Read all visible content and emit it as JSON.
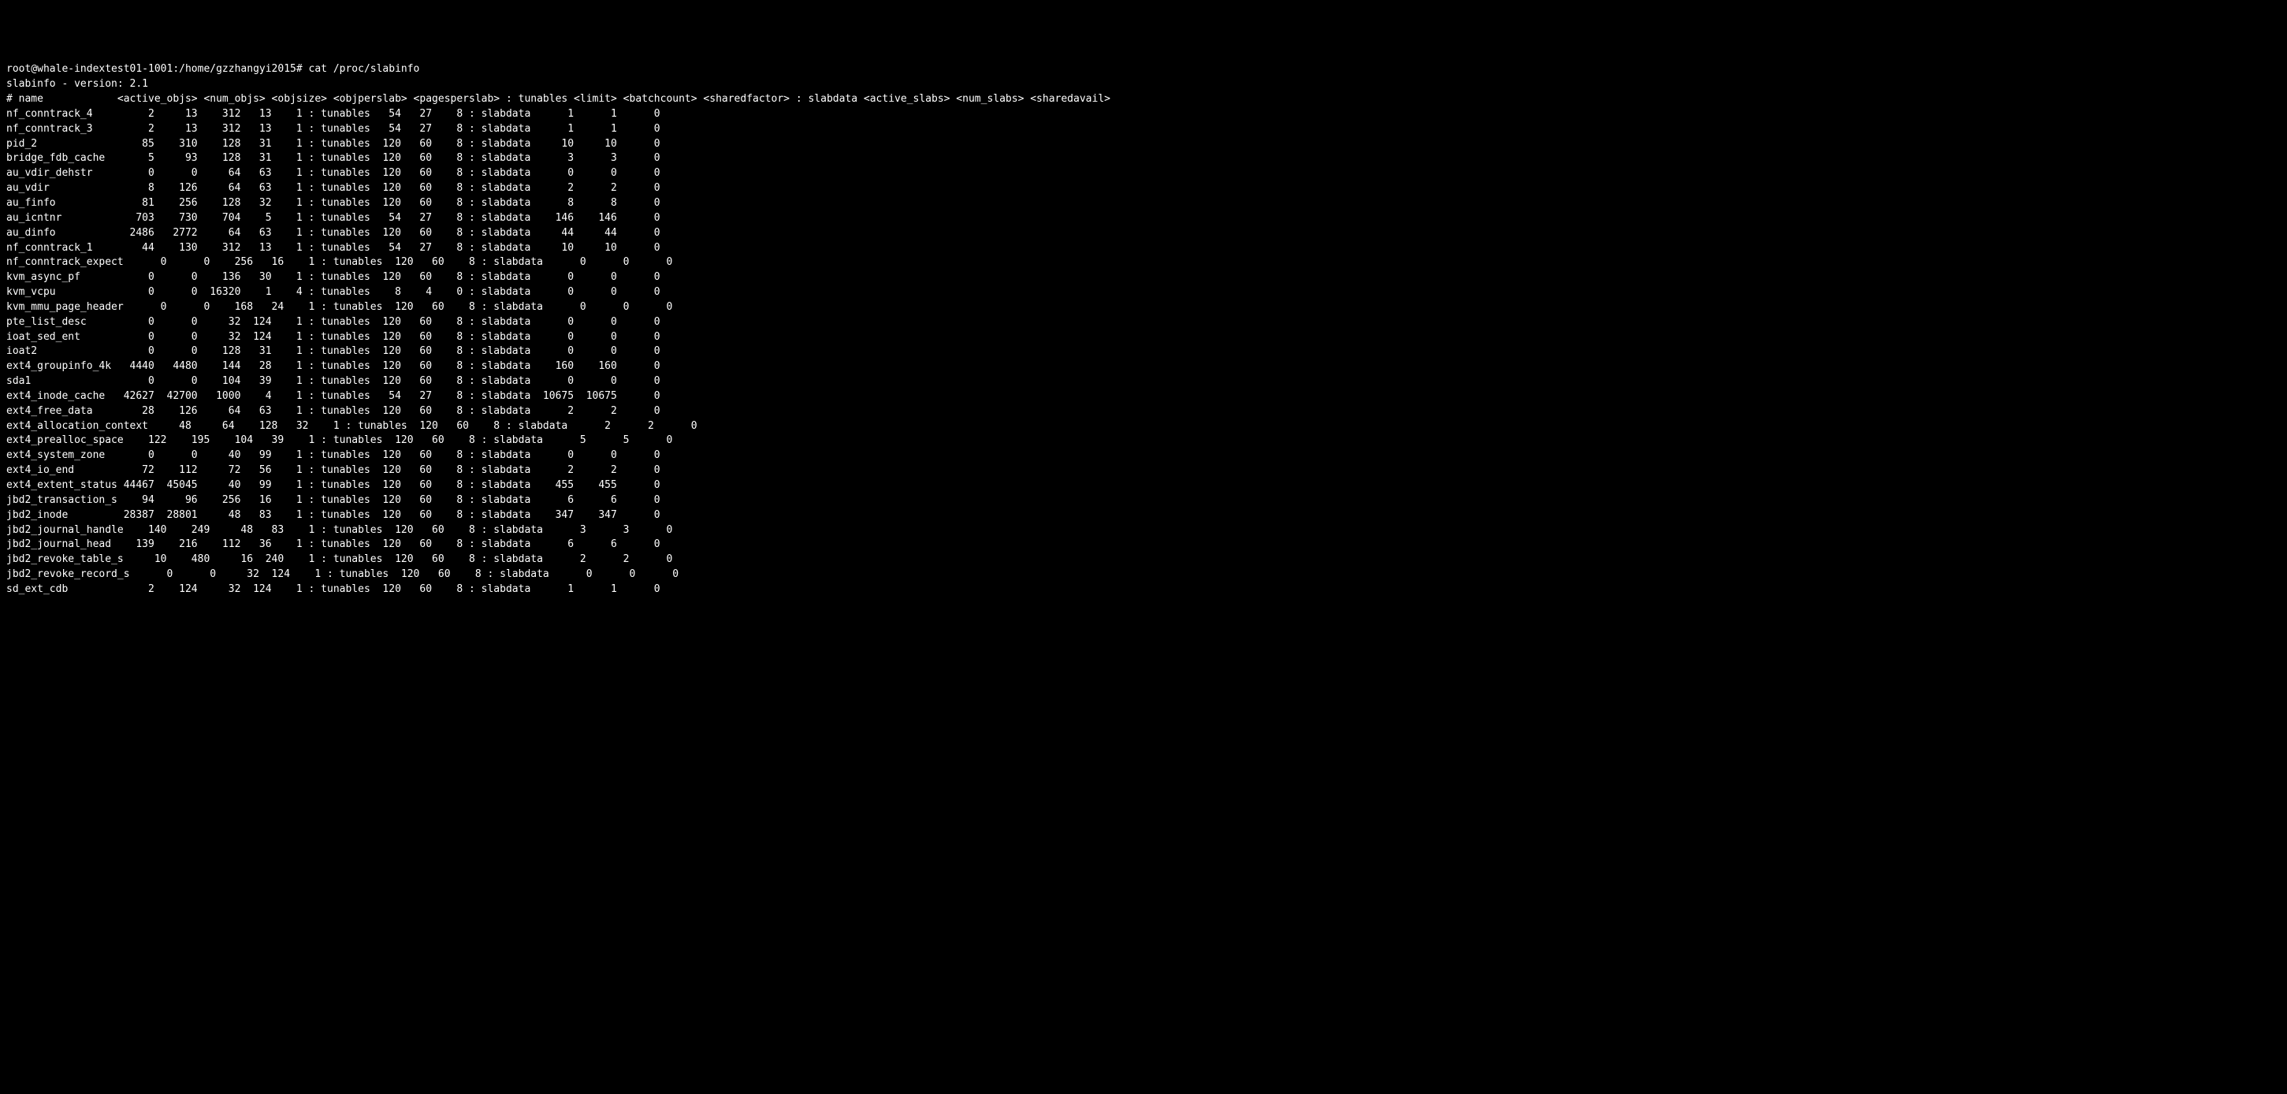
{
  "prompt": "root@whale-indextest01-1001:/home/gzzhangyi2015# ",
  "command": "cat /proc/slabinfo",
  "version_line": "slabinfo - version: 2.1",
  "header_line": "# name            <active_objs> <num_objs> <objsize> <objperslab> <pagesperslab> : tunables <limit> <batchcount> <sharedfactor> : slabdata <active_slabs> <num_slabs> <sharedavail>",
  "rows": [
    {
      "name": "nf_conntrack_4",
      "active_objs": 2,
      "num_objs": 13,
      "objsize": 312,
      "objperslab": 13,
      "pagesperslab": 1,
      "limit": 54,
      "batchcount": 27,
      "sharedfactor": 8,
      "active_slabs": 1,
      "num_slabs": 1,
      "sharedavail": 0
    },
    {
      "name": "nf_conntrack_3",
      "active_objs": 2,
      "num_objs": 13,
      "objsize": 312,
      "objperslab": 13,
      "pagesperslab": 1,
      "limit": 54,
      "batchcount": 27,
      "sharedfactor": 8,
      "active_slabs": 1,
      "num_slabs": 1,
      "sharedavail": 0
    },
    {
      "name": "pid_2",
      "active_objs": 85,
      "num_objs": 310,
      "objsize": 128,
      "objperslab": 31,
      "pagesperslab": 1,
      "limit": 120,
      "batchcount": 60,
      "sharedfactor": 8,
      "active_slabs": 10,
      "num_slabs": 10,
      "sharedavail": 0
    },
    {
      "name": "bridge_fdb_cache",
      "active_objs": 5,
      "num_objs": 93,
      "objsize": 128,
      "objperslab": 31,
      "pagesperslab": 1,
      "limit": 120,
      "batchcount": 60,
      "sharedfactor": 8,
      "active_slabs": 3,
      "num_slabs": 3,
      "sharedavail": 0
    },
    {
      "name": "au_vdir_dehstr",
      "active_objs": 0,
      "num_objs": 0,
      "objsize": 64,
      "objperslab": 63,
      "pagesperslab": 1,
      "limit": 120,
      "batchcount": 60,
      "sharedfactor": 8,
      "active_slabs": 0,
      "num_slabs": 0,
      "sharedavail": 0
    },
    {
      "name": "au_vdir",
      "active_objs": 8,
      "num_objs": 126,
      "objsize": 64,
      "objperslab": 63,
      "pagesperslab": 1,
      "limit": 120,
      "batchcount": 60,
      "sharedfactor": 8,
      "active_slabs": 2,
      "num_slabs": 2,
      "sharedavail": 0
    },
    {
      "name": "au_finfo",
      "active_objs": 81,
      "num_objs": 256,
      "objsize": 128,
      "objperslab": 32,
      "pagesperslab": 1,
      "limit": 120,
      "batchcount": 60,
      "sharedfactor": 8,
      "active_slabs": 8,
      "num_slabs": 8,
      "sharedavail": 0
    },
    {
      "name": "au_icntnr",
      "active_objs": 703,
      "num_objs": 730,
      "objsize": 704,
      "objperslab": 5,
      "pagesperslab": 1,
      "limit": 54,
      "batchcount": 27,
      "sharedfactor": 8,
      "active_slabs": 146,
      "num_slabs": 146,
      "sharedavail": 0
    },
    {
      "name": "au_dinfo",
      "active_objs": 2486,
      "num_objs": 2772,
      "objsize": 64,
      "objperslab": 63,
      "pagesperslab": 1,
      "limit": 120,
      "batchcount": 60,
      "sharedfactor": 8,
      "active_slabs": 44,
      "num_slabs": 44,
      "sharedavail": 0
    },
    {
      "name": "nf_conntrack_1",
      "active_objs": 44,
      "num_objs": 130,
      "objsize": 312,
      "objperslab": 13,
      "pagesperslab": 1,
      "limit": 54,
      "batchcount": 27,
      "sharedfactor": 8,
      "active_slabs": 10,
      "num_slabs": 10,
      "sharedavail": 0
    },
    {
      "name": "nf_conntrack_expect",
      "active_objs": 0,
      "num_objs": 0,
      "objsize": 256,
      "objperslab": 16,
      "pagesperslab": 1,
      "limit": 120,
      "batchcount": 60,
      "sharedfactor": 8,
      "active_slabs": 0,
      "num_slabs": 0,
      "sharedavail": 0
    },
    {
      "name": "kvm_async_pf",
      "active_objs": 0,
      "num_objs": 0,
      "objsize": 136,
      "objperslab": 30,
      "pagesperslab": 1,
      "limit": 120,
      "batchcount": 60,
      "sharedfactor": 8,
      "active_slabs": 0,
      "num_slabs": 0,
      "sharedavail": 0
    },
    {
      "name": "kvm_vcpu",
      "active_objs": 0,
      "num_objs": 0,
      "objsize": 16320,
      "objperslab": 1,
      "pagesperslab": 4,
      "limit": 8,
      "batchcount": 4,
      "sharedfactor": 0,
      "active_slabs": 0,
      "num_slabs": 0,
      "sharedavail": 0
    },
    {
      "name": "kvm_mmu_page_header",
      "active_objs": 0,
      "num_objs": 0,
      "objsize": 168,
      "objperslab": 24,
      "pagesperslab": 1,
      "limit": 120,
      "batchcount": 60,
      "sharedfactor": 8,
      "active_slabs": 0,
      "num_slabs": 0,
      "sharedavail": 0
    },
    {
      "name": "pte_list_desc",
      "active_objs": 0,
      "num_objs": 0,
      "objsize": 32,
      "objperslab": 124,
      "pagesperslab": 1,
      "limit": 120,
      "batchcount": 60,
      "sharedfactor": 8,
      "active_slabs": 0,
      "num_slabs": 0,
      "sharedavail": 0
    },
    {
      "name": "ioat_sed_ent",
      "active_objs": 0,
      "num_objs": 0,
      "objsize": 32,
      "objperslab": 124,
      "pagesperslab": 1,
      "limit": 120,
      "batchcount": 60,
      "sharedfactor": 8,
      "active_slabs": 0,
      "num_slabs": 0,
      "sharedavail": 0
    },
    {
      "name": "ioat2",
      "active_objs": 0,
      "num_objs": 0,
      "objsize": 128,
      "objperslab": 31,
      "pagesperslab": 1,
      "limit": 120,
      "batchcount": 60,
      "sharedfactor": 8,
      "active_slabs": 0,
      "num_slabs": 0,
      "sharedavail": 0
    },
    {
      "name": "ext4_groupinfo_4k",
      "active_objs": 4440,
      "num_objs": 4480,
      "objsize": 144,
      "objperslab": 28,
      "pagesperslab": 1,
      "limit": 120,
      "batchcount": 60,
      "sharedfactor": 8,
      "active_slabs": 160,
      "num_slabs": 160,
      "sharedavail": 0
    },
    {
      "name": "sda1",
      "active_objs": 0,
      "num_objs": 0,
      "objsize": 104,
      "objperslab": 39,
      "pagesperslab": 1,
      "limit": 120,
      "batchcount": 60,
      "sharedfactor": 8,
      "active_slabs": 0,
      "num_slabs": 0,
      "sharedavail": 0
    },
    {
      "name": "ext4_inode_cache",
      "active_objs": 42627,
      "num_objs": 42700,
      "objsize": 1000,
      "objperslab": 4,
      "pagesperslab": 1,
      "limit": 54,
      "batchcount": 27,
      "sharedfactor": 8,
      "active_slabs": 10675,
      "num_slabs": 10675,
      "sharedavail": 0
    },
    {
      "name": "ext4_free_data",
      "active_objs": 28,
      "num_objs": 126,
      "objsize": 64,
      "objperslab": 63,
      "pagesperslab": 1,
      "limit": 120,
      "batchcount": 60,
      "sharedfactor": 8,
      "active_slabs": 2,
      "num_slabs": 2,
      "sharedavail": 0
    },
    {
      "name": "ext4_allocation_context",
      "active_objs": 48,
      "num_objs": 64,
      "objsize": 128,
      "objperslab": 32,
      "pagesperslab": 1,
      "limit": 120,
      "batchcount": 60,
      "sharedfactor": 8,
      "active_slabs": 2,
      "num_slabs": 2,
      "sharedavail": 0
    },
    {
      "name": "ext4_prealloc_space",
      "active_objs": 122,
      "num_objs": 195,
      "objsize": 104,
      "objperslab": 39,
      "pagesperslab": 1,
      "limit": 120,
      "batchcount": 60,
      "sharedfactor": 8,
      "active_slabs": 5,
      "num_slabs": 5,
      "sharedavail": 0
    },
    {
      "name": "ext4_system_zone",
      "active_objs": 0,
      "num_objs": 0,
      "objsize": 40,
      "objperslab": 99,
      "pagesperslab": 1,
      "limit": 120,
      "batchcount": 60,
      "sharedfactor": 8,
      "active_slabs": 0,
      "num_slabs": 0,
      "sharedavail": 0
    },
    {
      "name": "ext4_io_end",
      "active_objs": 72,
      "num_objs": 112,
      "objsize": 72,
      "objperslab": 56,
      "pagesperslab": 1,
      "limit": 120,
      "batchcount": 60,
      "sharedfactor": 8,
      "active_slabs": 2,
      "num_slabs": 2,
      "sharedavail": 0
    },
    {
      "name": "ext4_extent_status",
      "active_objs": 44467,
      "num_objs": 45045,
      "objsize": 40,
      "objperslab": 99,
      "pagesperslab": 1,
      "limit": 120,
      "batchcount": 60,
      "sharedfactor": 8,
      "active_slabs": 455,
      "num_slabs": 455,
      "sharedavail": 0
    },
    {
      "name": "jbd2_transaction_s",
      "active_objs": 94,
      "num_objs": 96,
      "objsize": 256,
      "objperslab": 16,
      "pagesperslab": 1,
      "limit": 120,
      "batchcount": 60,
      "sharedfactor": 8,
      "active_slabs": 6,
      "num_slabs": 6,
      "sharedavail": 0
    },
    {
      "name": "jbd2_inode",
      "active_objs": 28387,
      "num_objs": 28801,
      "objsize": 48,
      "objperslab": 83,
      "pagesperslab": 1,
      "limit": 120,
      "batchcount": 60,
      "sharedfactor": 8,
      "active_slabs": 347,
      "num_slabs": 347,
      "sharedavail": 0
    },
    {
      "name": "jbd2_journal_handle",
      "active_objs": 140,
      "num_objs": 249,
      "objsize": 48,
      "objperslab": 83,
      "pagesperslab": 1,
      "limit": 120,
      "batchcount": 60,
      "sharedfactor": 8,
      "active_slabs": 3,
      "num_slabs": 3,
      "sharedavail": 0
    },
    {
      "name": "jbd2_journal_head",
      "active_objs": 139,
      "num_objs": 216,
      "objsize": 112,
      "objperslab": 36,
      "pagesperslab": 1,
      "limit": 120,
      "batchcount": 60,
      "sharedfactor": 8,
      "active_slabs": 6,
      "num_slabs": 6,
      "sharedavail": 0
    },
    {
      "name": "jbd2_revoke_table_s",
      "active_objs": 10,
      "num_objs": 480,
      "objsize": 16,
      "objperslab": 240,
      "pagesperslab": 1,
      "limit": 120,
      "batchcount": 60,
      "sharedfactor": 8,
      "active_slabs": 2,
      "num_slabs": 2,
      "sharedavail": 0
    },
    {
      "name": "jbd2_revoke_record_s",
      "active_objs": 0,
      "num_objs": 0,
      "objsize": 32,
      "objperslab": 124,
      "pagesperslab": 1,
      "limit": 120,
      "batchcount": 60,
      "sharedfactor": 8,
      "active_slabs": 0,
      "num_slabs": 0,
      "sharedavail": 0
    },
    {
      "name": "sd_ext_cdb",
      "active_objs": 2,
      "num_objs": 124,
      "objsize": 32,
      "objperslab": 124,
      "pagesperslab": 1,
      "limit": 120,
      "batchcount": 60,
      "sharedfactor": 8,
      "active_slabs": 1,
      "num_slabs": 1,
      "sharedavail": 0
    }
  ]
}
